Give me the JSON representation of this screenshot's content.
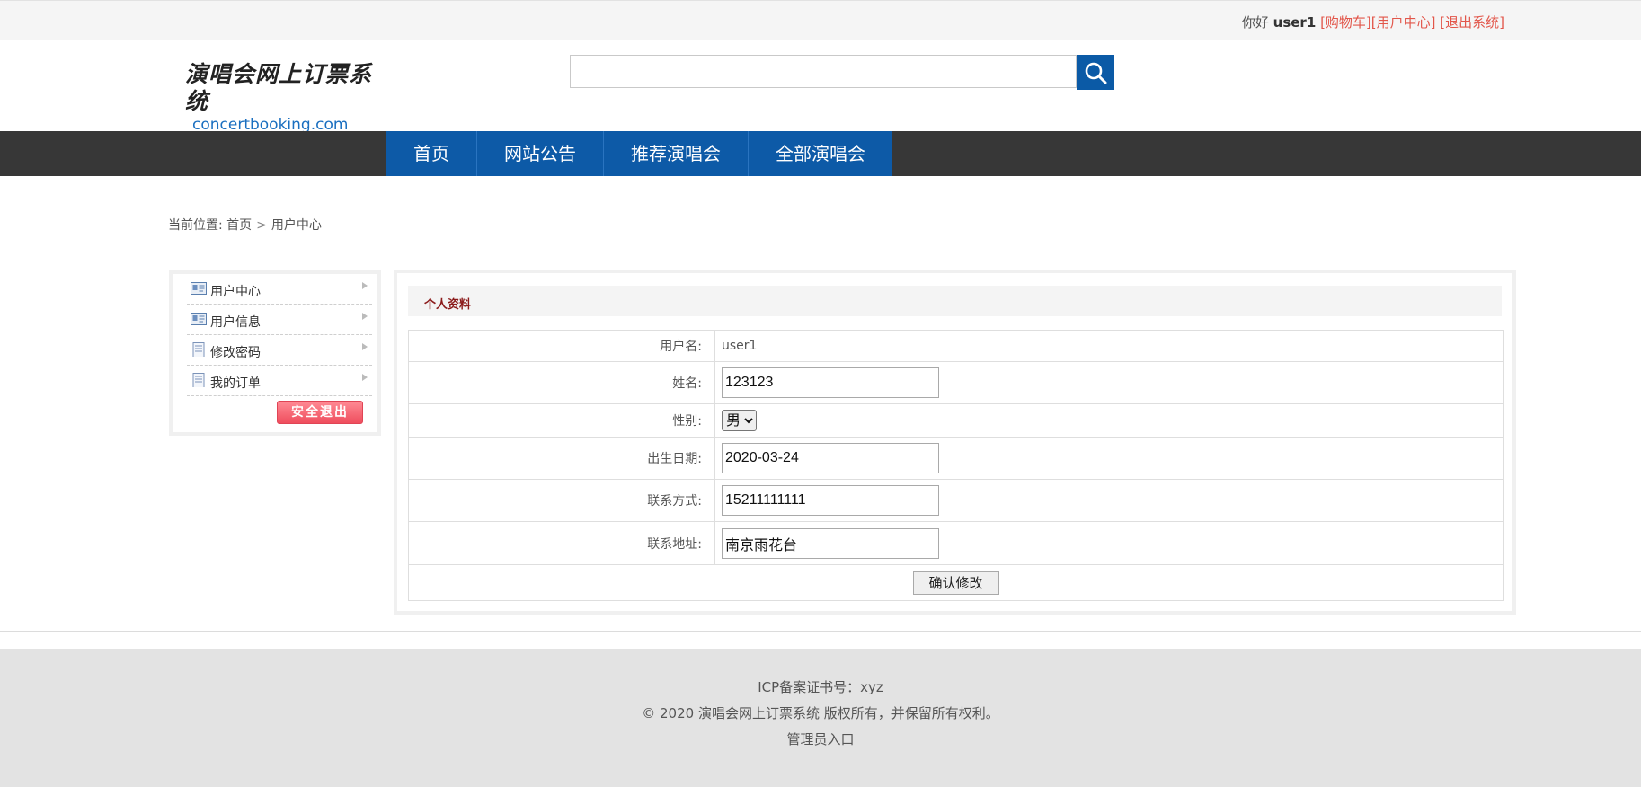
{
  "topbar": {
    "greeting": "你好",
    "username": "user1",
    "cart_link": "[购物车]",
    "user_center_link": "[用户中心]",
    "logout_link": "[退出系统]"
  },
  "header": {
    "logo_title": "演唱会网上订票系统",
    "logo_domain": "concertbooking.com",
    "search_value": ""
  },
  "nav": {
    "items": [
      "首页",
      "网站公告",
      "推荐演唱会",
      "全部演唱会"
    ]
  },
  "breadcrumb": {
    "prefix": "当前位置:",
    "home": "首页",
    "sep": ">",
    "current": "用户中心"
  },
  "sidebar": {
    "items": [
      {
        "label": "用户中心",
        "icon": "id-card-icon"
      },
      {
        "label": "用户信息",
        "icon": "id-card-icon"
      },
      {
        "label": "修改密码",
        "icon": "document-icon"
      },
      {
        "label": "我的订单",
        "icon": "document-icon"
      }
    ],
    "logout_button": "安全退出"
  },
  "profile": {
    "title": "个人资料",
    "username_label": "用户名:",
    "username_value": "user1",
    "name_label": "姓名:",
    "name_value": "123123",
    "gender_label": "性别:",
    "gender_value": "男",
    "birth_label": "出生日期:",
    "birth_value": "2020-03-24",
    "phone_label": "联系方式:",
    "phone_value": "15211111111",
    "address_label": "联系地址:",
    "address_value": "南京雨花台",
    "submit_button": "确认修改"
  },
  "footer": {
    "icp": "ICP备案证书号：xyz",
    "copyright": "© 2020 演唱会网上订票系统 版权所有，并保留所有权利。",
    "admin_link": "管理员入口"
  },
  "colors": {
    "nav_bg": "#373737",
    "nav_item_bg": "#0d5aa7",
    "link_red": "#e2564a",
    "panel_title": "#8b1a1a",
    "footer_bg": "#e3e3e3"
  }
}
